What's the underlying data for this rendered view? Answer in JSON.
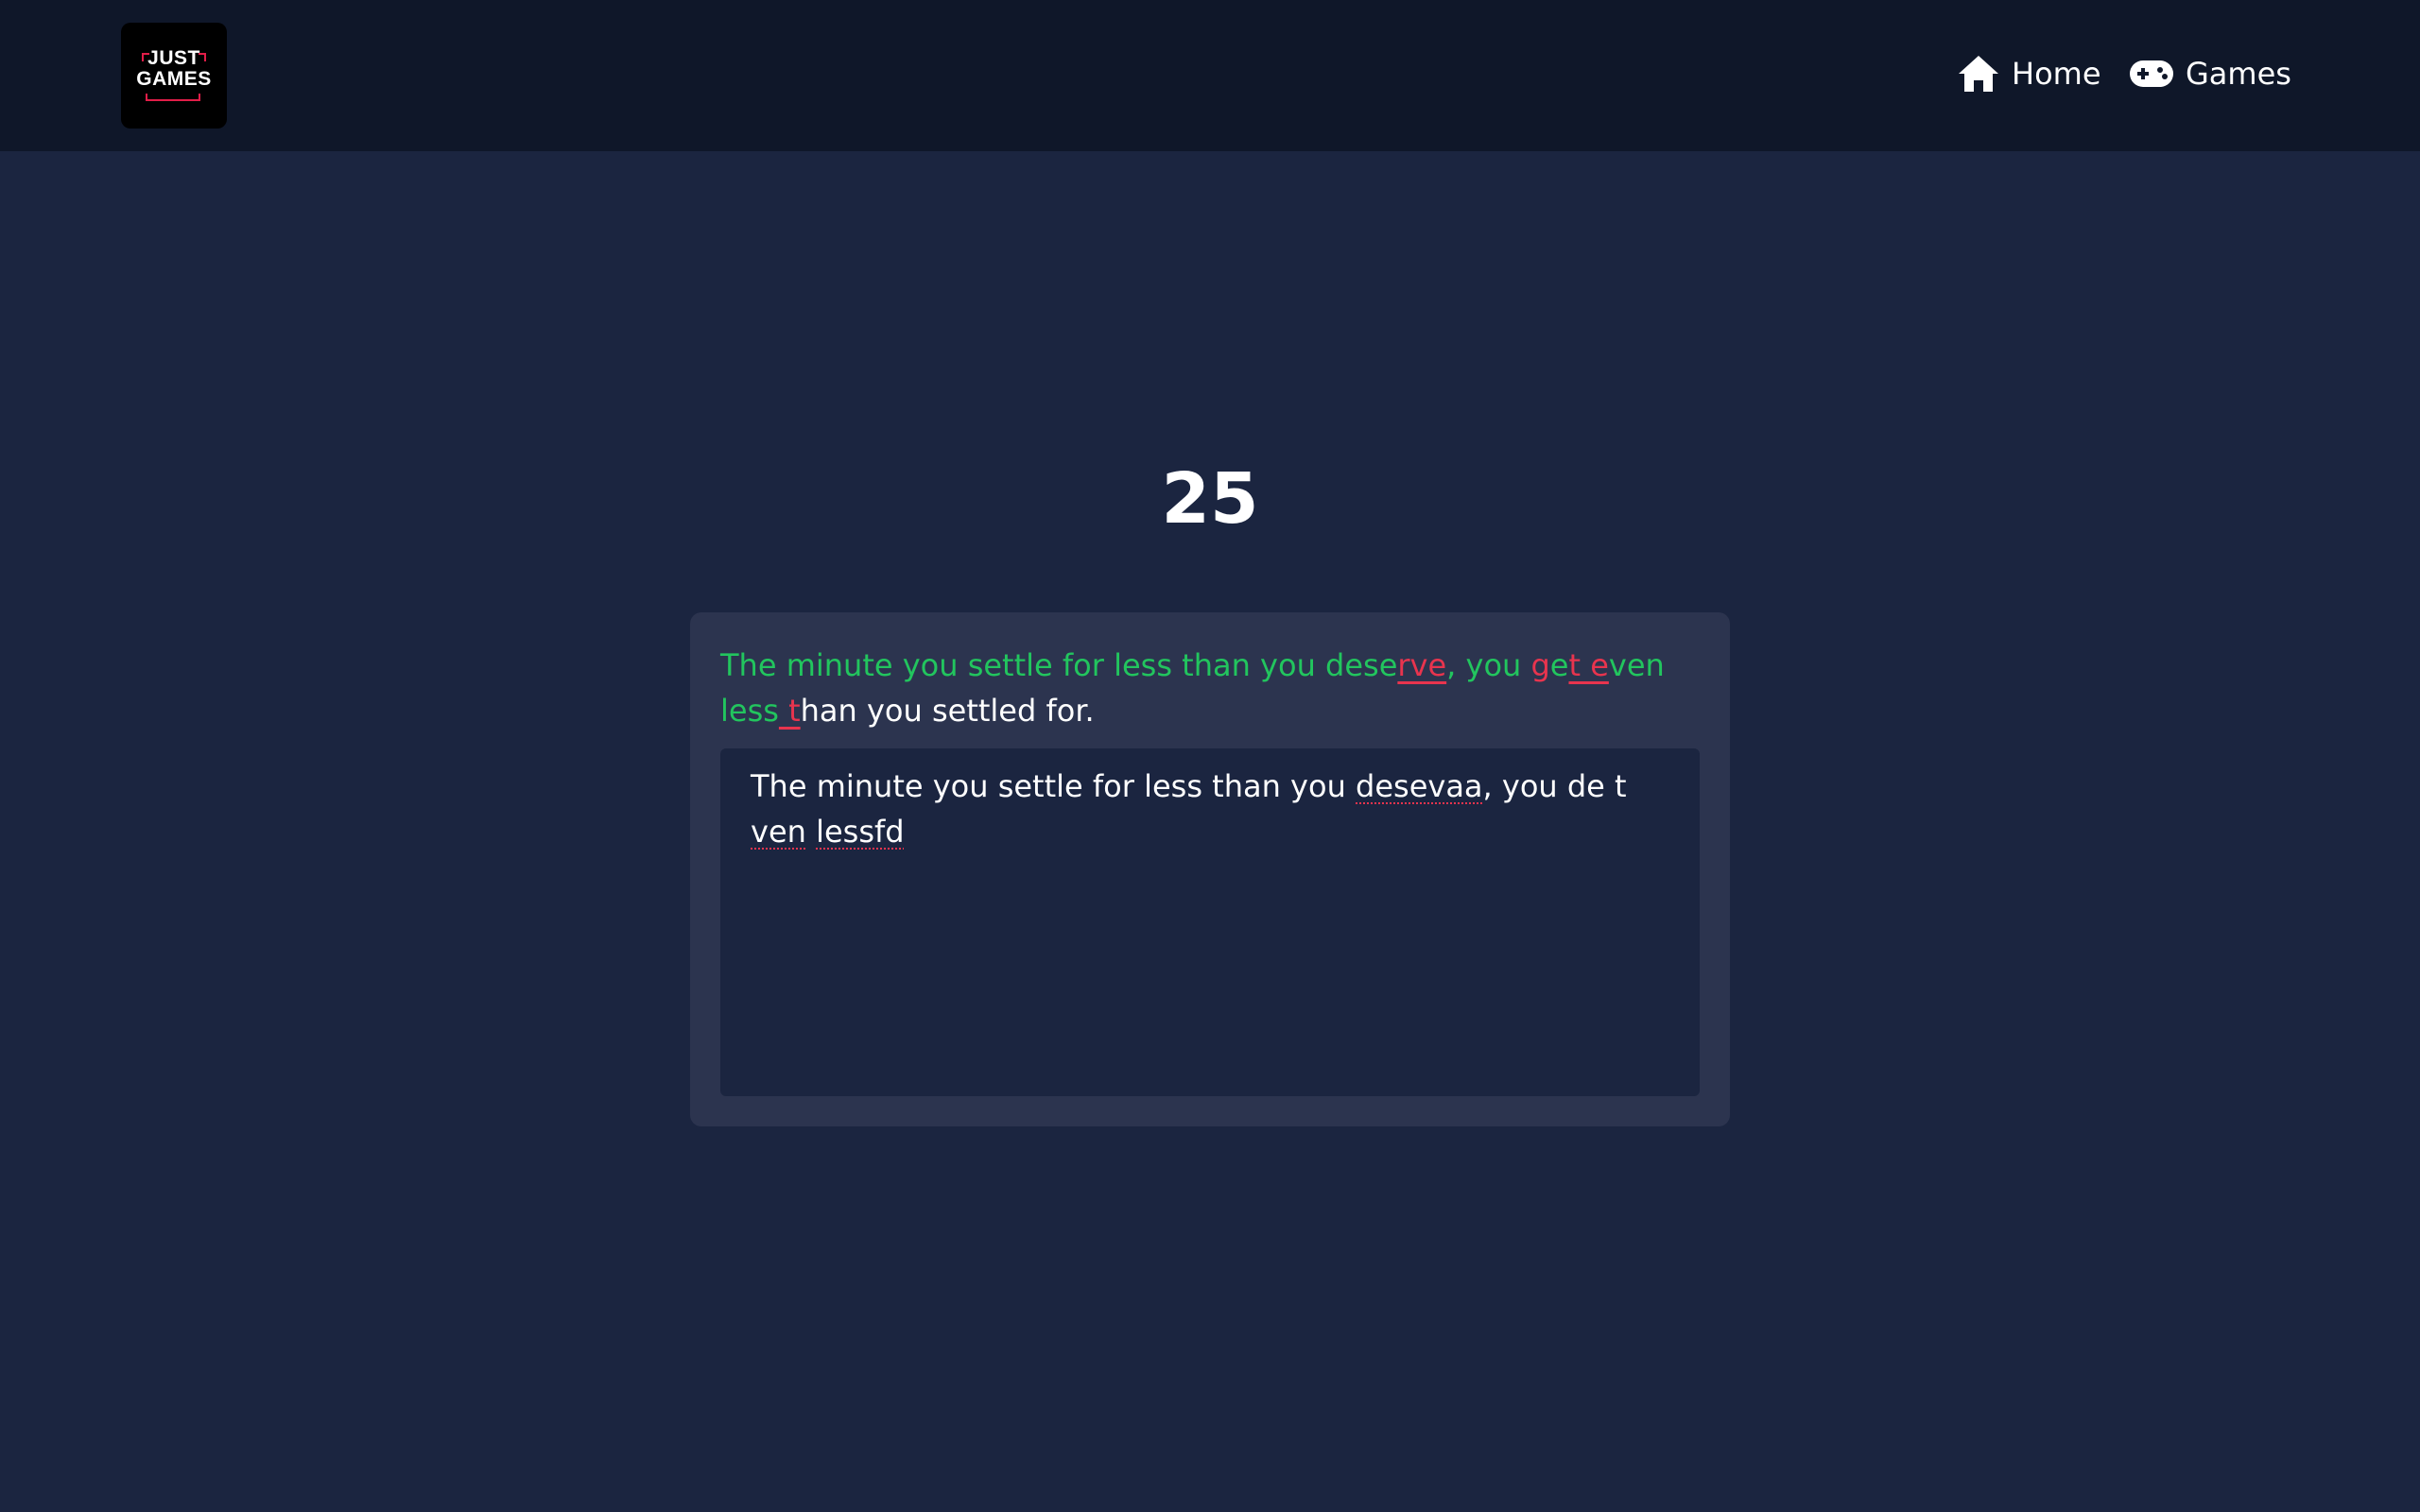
{
  "logo": {
    "line1": "JUST",
    "line2": "GAMES"
  },
  "nav": {
    "home_label": "Home",
    "games_label": "Games",
    "home_icon": "home-icon",
    "games_icon": "gamepad-icon"
  },
  "timer": {
    "value": "25"
  },
  "quote": {
    "segments": [
      {
        "text": "The minute you settle for less than you dese",
        "state": "correct"
      },
      {
        "text": "rve",
        "state": "error-underlined"
      },
      {
        "text": ", you ",
        "state": "correct"
      },
      {
        "text": "g",
        "state": "error"
      },
      {
        "text": "e",
        "state": "correct"
      },
      {
        "text": "t e",
        "state": "error-underlined"
      },
      {
        "text": "ven less",
        "state": "correct"
      },
      {
        "text": " t",
        "state": "error-underlined"
      },
      {
        "text": "han you settled for.",
        "state": "pending"
      }
    ]
  },
  "input": {
    "segments": [
      {
        "text": "The minute you settle for less than you ",
        "spell": false
      },
      {
        "text": "desevaa",
        "spell": true
      },
      {
        "text": ", you de t ",
        "spell": false
      },
      {
        "text": "ven",
        "spell": true
      },
      {
        "text": " ",
        "spell": false
      },
      {
        "text": "lessfd",
        "spell": true
      }
    ]
  },
  "colors": {
    "correct": "#22c55e",
    "error": "#e8344e",
    "pending": "#ffffff",
    "header_bg": "#0f1729",
    "page_bg": "#1b2540",
    "card_bg": "#2c344f"
  }
}
